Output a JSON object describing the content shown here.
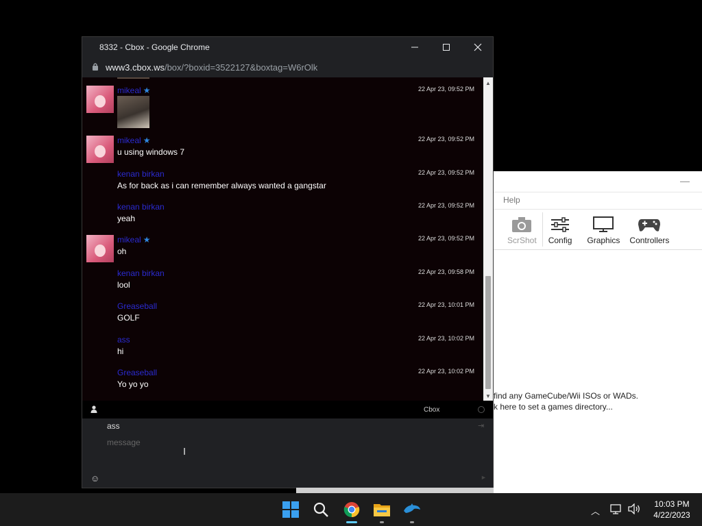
{
  "browser": {
    "title": "8332 - Cbox - Google Chrome",
    "host": "www3.cbox.ws",
    "path": "/box/?boxid=3522127&boxtag=W6rOlk"
  },
  "chat": {
    "messages": [
      {
        "user": "mikeal",
        "time": "22 Apr 23, 09:52 PM",
        "text": "",
        "image": true
      },
      {
        "user": "mikeal",
        "time": "22 Apr 23, 09:52 PM",
        "text": "u using windows 7"
      },
      {
        "user": "kenan birkan",
        "time": "22 Apr 23, 09:52 PM",
        "text": "As for back as i can remember always wanted a gangstar"
      },
      {
        "user": "kenan birkan",
        "time": "22 Apr 23, 09:52 PM",
        "text": "yeah"
      },
      {
        "user": "mikeal",
        "time": "22 Apr 23, 09:52 PM",
        "text": "oh"
      },
      {
        "user": "kenan birkan",
        "time": "22 Apr 23, 09:58 PM",
        "text": "lool"
      },
      {
        "user": "Greaseball",
        "time": "22 Apr 23, 10:01 PM",
        "text": "GOLF"
      },
      {
        "user": "ass",
        "time": "22 Apr 23, 10:02 PM",
        "text": "hi"
      },
      {
        "user": "Greaseball",
        "time": "22 Apr 23, 10:02 PM",
        "text": "Yo yo yo"
      }
    ],
    "brand": "Cbox",
    "name_value": "ass",
    "message_placeholder": "message"
  },
  "background_app": {
    "menu_help": "Help",
    "toolbar": [
      "ScrShot",
      "Config",
      "Graphics",
      "Controllers"
    ],
    "empty_line1": "find any GameCube/Wii ISOs or WADs.",
    "empty_line2": "k here to set a games directory..."
  },
  "taskbar": {
    "time": "10:03 PM",
    "date": "4/22/2023"
  },
  "colors": {
    "username": "#2b2bd1",
    "star": "#2f87e0",
    "chat_bg": "#0c0204"
  }
}
